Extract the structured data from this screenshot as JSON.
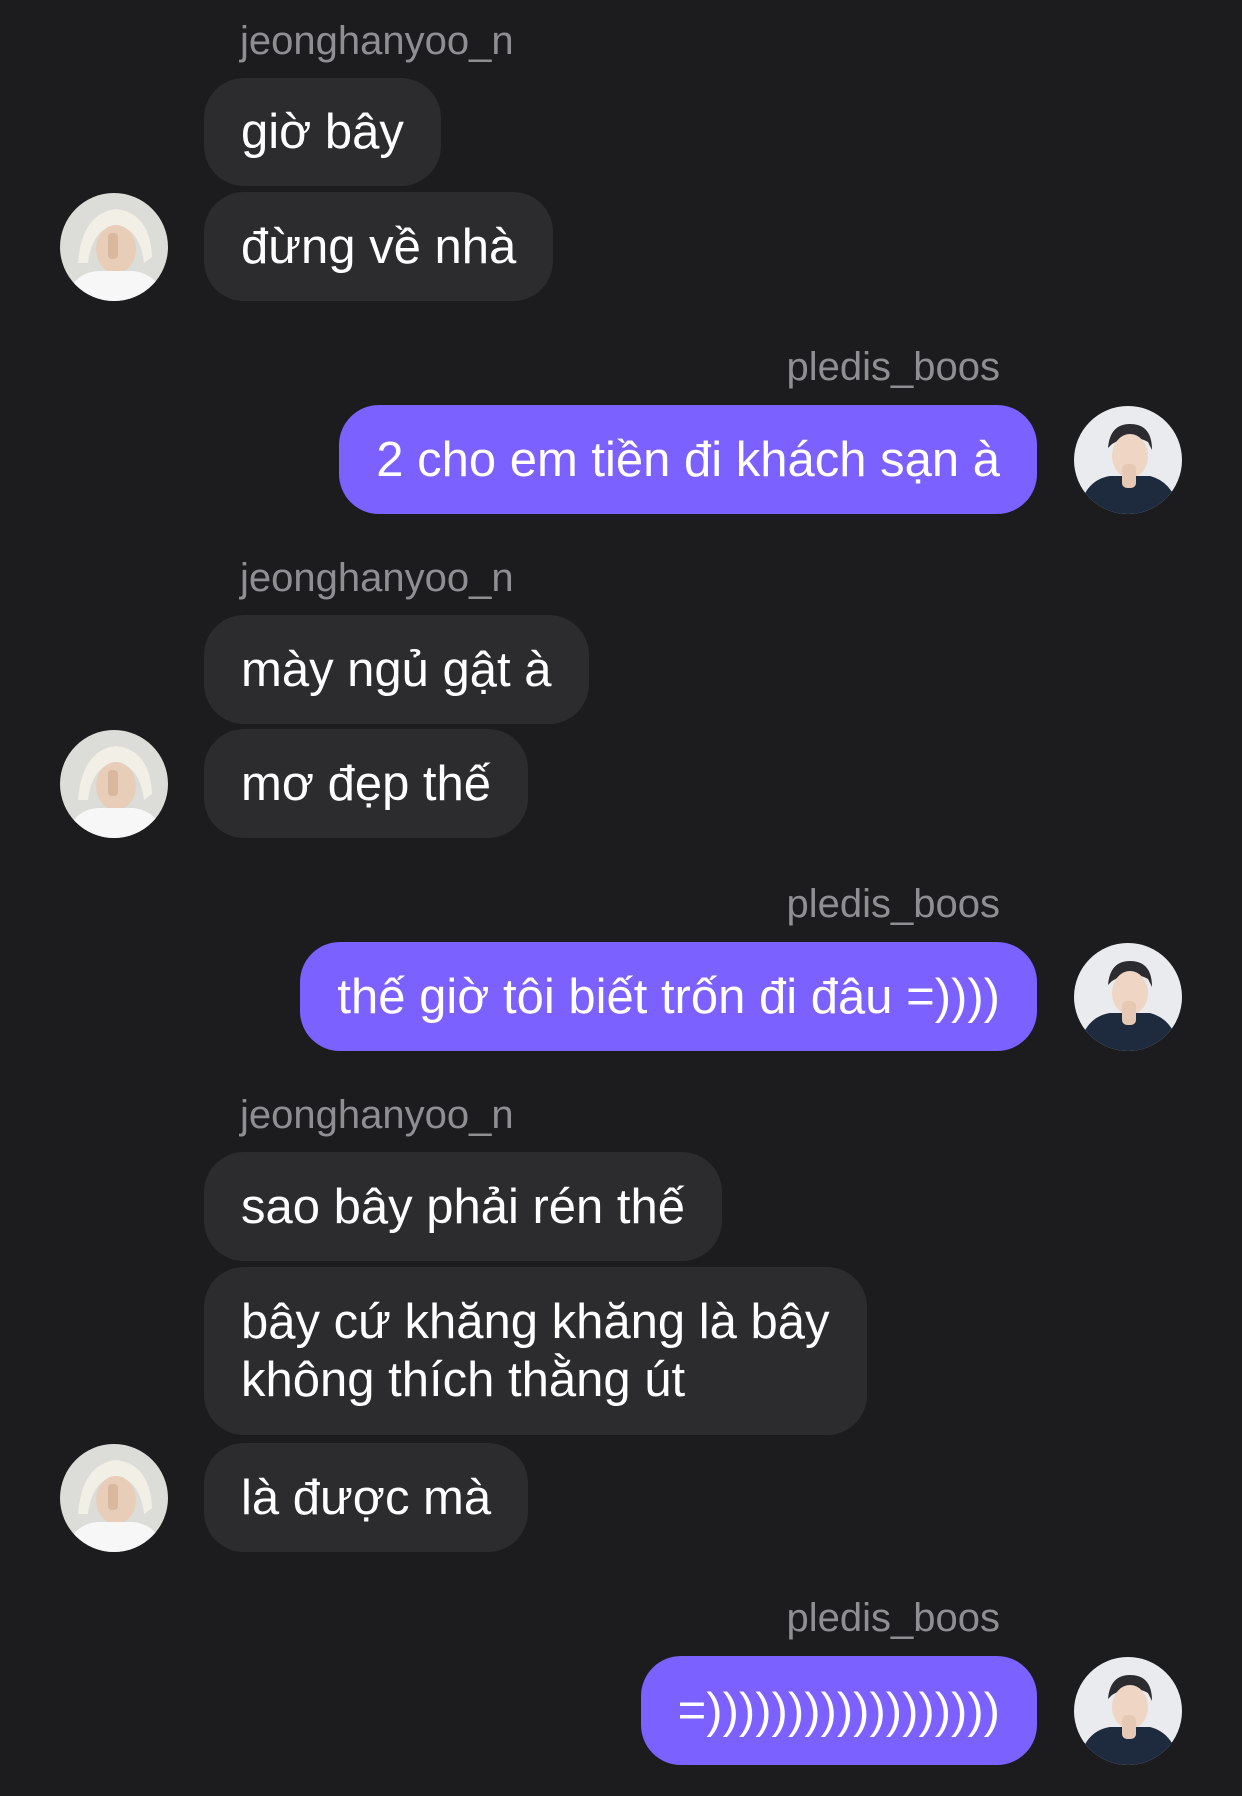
{
  "conversation": {
    "messages": [
      {
        "sender": "jeonghanyoo_n",
        "text": "giờ bây"
      },
      {
        "sender": "jeonghanyoo_n",
        "text": "đừng về nhà"
      },
      {
        "sender": "pledis_boos",
        "text": "2 cho em tiền đi khách sạn à"
      },
      {
        "sender": "jeonghanyoo_n",
        "text": "mày ngủ gật à"
      },
      {
        "sender": "jeonghanyoo_n",
        "text": "mơ đẹp thế"
      },
      {
        "sender": "pledis_boos",
        "text": "thế giờ tôi biết trốn đi đâu =))))"
      },
      {
        "sender": "jeonghanyoo_n",
        "text": "sao bây phải rén thế"
      },
      {
        "sender": "jeonghanyoo_n",
        "lines": [
          "bây cứ khăng khăng là bây",
          "không thích thằng út"
        ]
      },
      {
        "sender": "jeonghanyoo_n",
        "text": "là được mà"
      },
      {
        "sender": "pledis_boos",
        "text": "=))))))))))))))))))"
      }
    ]
  },
  "colors": {
    "background": "#1c1c1e",
    "incoming_bubble": "#2c2c2e",
    "outgoing_bubble": "#7b61ff",
    "username": "#8e8e93"
  }
}
